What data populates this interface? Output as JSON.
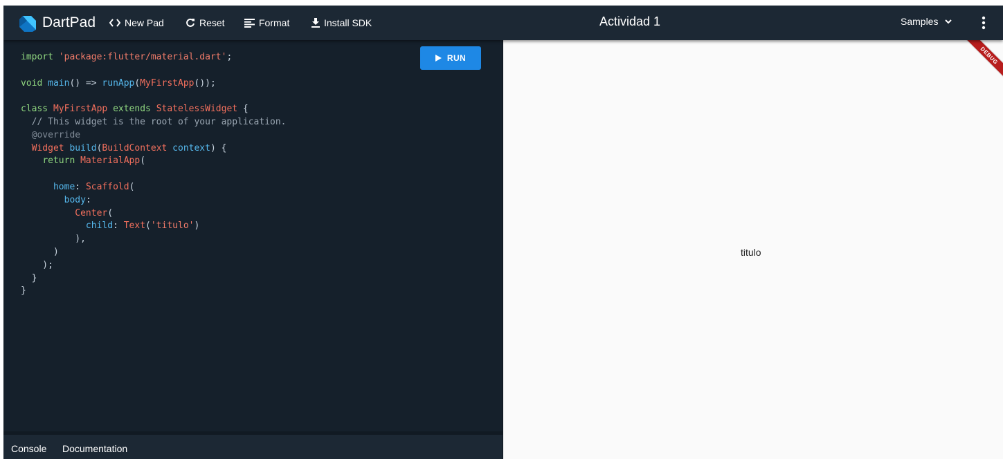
{
  "header": {
    "brand": "DartPad",
    "new_pad": "New Pad",
    "reset": "Reset",
    "format": "Format",
    "install_sdk": "Install SDK",
    "title": "Actividad 1",
    "samples": "Samples"
  },
  "editor": {
    "run_label": "RUN",
    "lines": [
      "import 'package:flutter/material.dart';",
      "",
      "void main() => runApp(MyFirstApp());",
      "",
      "class MyFirstApp extends StatelessWidget {",
      "  // This widget is the root of your application.",
      "  @override",
      "  Widget build(BuildContext context) {",
      "    return MaterialApp(",
      "",
      "      home: Scaffold(",
      "        body:",
      "          Center(",
      "            child: Text('titulo')",
      "          ),",
      "      )",
      "    );",
      "  }",
      "}"
    ]
  },
  "bottom": {
    "console": "Console",
    "documentation": "Documentation"
  },
  "output": {
    "text": "titulo",
    "banner": "DEBUG"
  },
  "colors": {
    "header_bg": "#1c2834",
    "editor_bg": "#15202b",
    "run_button": "#1e88e5",
    "output_bg": "#fafafa",
    "debug_banner": "#b71c1c"
  },
  "icons": {
    "logo": "dart-logo-icon",
    "new_pad": "code-brackets-icon",
    "reset": "refresh-icon",
    "format": "format-lines-icon",
    "install_sdk": "download-icon",
    "run": "play-icon",
    "samples": "chevron-down-icon",
    "menu": "more-vert-icon"
  }
}
